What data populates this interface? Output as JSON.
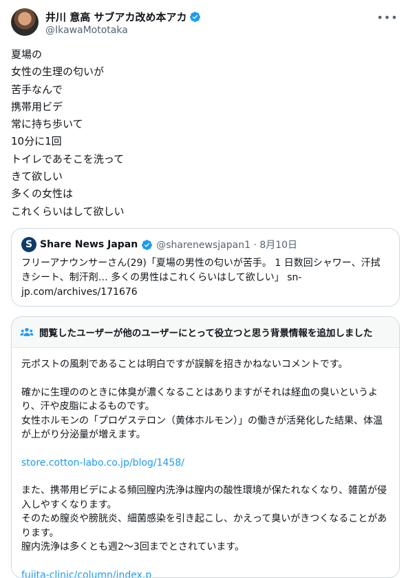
{
  "author": {
    "display_name": "井川 意高 サブアカ改め本アカ",
    "handle": "@IkawaMototaka"
  },
  "tweet_lines": [
    "夏場の",
    "女性の生理の匂いが",
    "苦手なんで",
    "携帯用ビデ",
    "常に持ち歩いて",
    "10分に1回",
    "トイレであそこを洗って",
    "きて欲しい",
    "多くの女性は",
    "これくらいはして欲しい"
  ],
  "quote": {
    "logo_letter": "S",
    "name": "Share News Japan",
    "handle_date": "@sharenewsjapan1 · 8月10日",
    "text": "フリーアナウンサーさん(29)「夏場の男性の匂いが苦手。 1 日数回シャワー、汗拭きシート、制汗剤… 多くの男性はこれくらいはして欲しい」 sn-jp.com/archives/171676"
  },
  "community_note": {
    "title": "閲覧したユーザーが他のユーザーにとって役立つと思う背景情報を追加しました",
    "p1": "元ポストの風刺であることは明白ですが誤解を招きかねないコメントです。",
    "p2": "確かに生理ののときに体臭が濃くなることはありますがそれは経血の臭いというより、汗や皮脂によるものです。\n女性ホルモンの「プロゲステロン（黄体ホルモン）」の働きが活発化した結果、体温が上がり分泌量が増えます。",
    "link1": "store.cotton-labo.co.jp/blog/1458/",
    "p3": "また、携帯用ビデによる頻回膣内洗浄は膣内の酸性環境が保たれなくなり、雑菌が侵入しやすくなります。\nそのため膣炎や膀胱炎、細菌感染を引き起こし、かえって臭いがきつくなることがあります。\n膣内洗浄は多くとも週2〜3回までとされています。",
    "link2": "fujita-clinic/column/index.p"
  },
  "colors": {
    "accent": "#1d9bf0",
    "text": "#0f1419",
    "muted": "#536471",
    "border": "#cfd9de"
  },
  "icons": [
    "verified-badge-icon",
    "more-dots-icon",
    "people-icon"
  ]
}
